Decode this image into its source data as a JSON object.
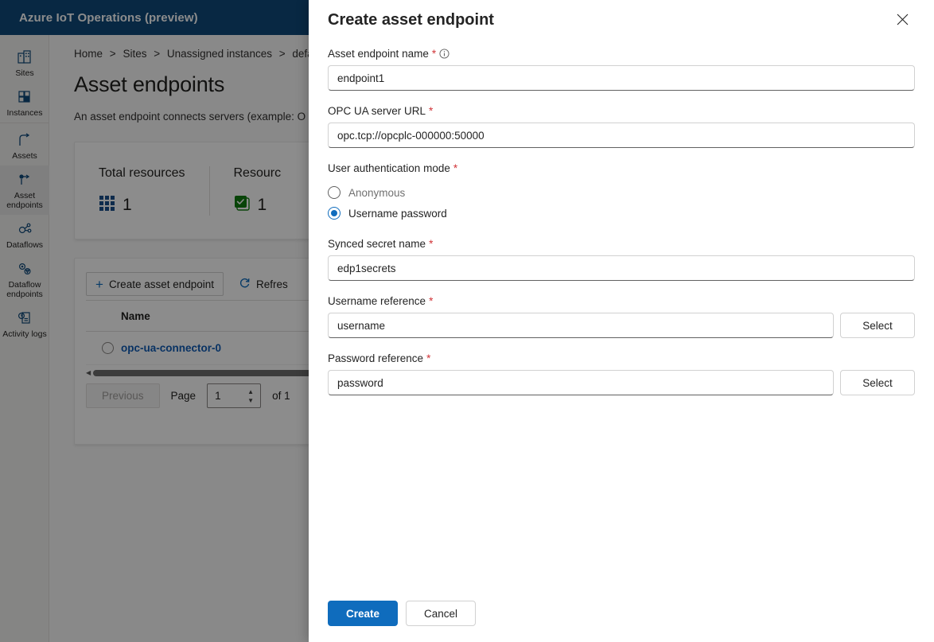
{
  "app": {
    "title": "Azure IoT Operations (preview)",
    "header_color": "#0f4a7b"
  },
  "sidebar": {
    "items": [
      {
        "label": "Sites",
        "icon": "sites-icon",
        "active": false
      },
      {
        "label": "Instances",
        "icon": "instances-icon",
        "active": false
      },
      {
        "label": "Assets",
        "icon": "assets-icon",
        "active": false
      },
      {
        "label": "Asset endpoints",
        "icon": "asset-endpoints-icon",
        "active": true
      },
      {
        "label": "Dataflows",
        "icon": "dataflows-icon",
        "active": false
      },
      {
        "label": "Dataflow endpoints",
        "icon": "dataflow-endpoints-icon",
        "active": false
      },
      {
        "label": "Activity logs",
        "icon": "activity-logs-icon",
        "active": false
      }
    ]
  },
  "page": {
    "breadcrumb": [
      "Home",
      "Sites",
      "Unassigned instances",
      "default"
    ],
    "breadcrumb_separator": ">",
    "title": "Asset endpoints",
    "description": "An asset endpoint connects servers (example: O",
    "stats": [
      {
        "label": "Total resources",
        "value": "1",
        "icon": "grid-icon",
        "color": "#1a4f8b"
      },
      {
        "label": "Resourc",
        "value": "1",
        "icon": "check-icon",
        "color": "#107c10"
      }
    ],
    "toolbar": {
      "create_label": "Create asset endpoint",
      "create_icon": "plus-icon",
      "refresh_label": "Refres",
      "refresh_icon": "refresh-icon"
    },
    "table": {
      "columns": [
        "Name"
      ],
      "rows": [
        {
          "name": "opc-ua-connector-0",
          "selected": false
        }
      ]
    },
    "pagination": {
      "previous_label": "Previous",
      "page_label": "Page",
      "page_value": "1",
      "of_label": "of 1"
    }
  },
  "panel": {
    "title": "Create asset endpoint",
    "close_icon": "close-icon",
    "fields": {
      "endpoint_name": {
        "label": "Asset endpoint name",
        "required": "*",
        "info_icon": "info-icon",
        "value": "endpoint1",
        "placeholder": ""
      },
      "server_url": {
        "label": "OPC UA server URL",
        "required": "*",
        "value": "opc.tcp://opcplc-000000:50000",
        "placeholder": ""
      },
      "auth_mode": {
        "label": "User authentication mode",
        "required": "*",
        "options": [
          {
            "label": "Anonymous",
            "selected": false
          },
          {
            "label": "Username password",
            "selected": true
          }
        ]
      },
      "secret_name": {
        "label": "Synced secret name",
        "required": "*",
        "value": "edp1secrets",
        "placeholder": ""
      },
      "username_ref": {
        "label": "Username reference",
        "required": "*",
        "value": "username",
        "placeholder": "",
        "button_label": "Select"
      },
      "password_ref": {
        "label": "Password reference",
        "required": "*",
        "value": "password",
        "placeholder": "",
        "button_label": "Select"
      }
    },
    "actions": {
      "primary_label": "Create",
      "secondary_label": "Cancel",
      "primary_color": "#0f6cbd"
    }
  }
}
